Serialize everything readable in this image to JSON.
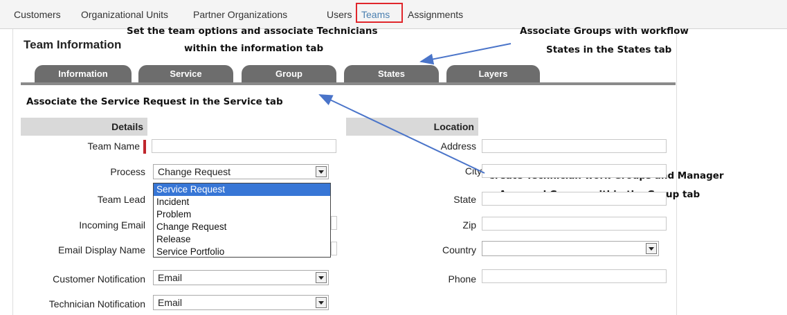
{
  "nav": {
    "items": [
      {
        "label": "Customers"
      },
      {
        "label": "Organizational Units"
      },
      {
        "label": "Partner Organizations"
      },
      {
        "label": "Users"
      },
      {
        "label": "Teams"
      },
      {
        "label": "Assignments"
      }
    ],
    "active": "Teams"
  },
  "panel": {
    "title": "Team Information"
  },
  "tabs": [
    {
      "label": "Information"
    },
    {
      "label": "Service"
    },
    {
      "label": "Group"
    },
    {
      "label": "States"
    },
    {
      "label": "Layers"
    }
  ],
  "callouts": {
    "team_options_line1": "Set the team options and associate Technicians",
    "team_options_line2": "within the information tab",
    "groups_states_line1": "Associate Groups with workflow",
    "groups_states_line2": "States in the States tab",
    "service": "Associate the Service Request in the Service tab",
    "group_line1": "Create Technician work Groups and Manager",
    "group_line2": "Approval Groups within the Group tab"
  },
  "details": {
    "header": "Details",
    "team_name_label": "Team Name",
    "process_label": "Process",
    "process_value": "Change Request",
    "team_lead_label": "Team Lead",
    "incoming_email_label": "Incoming Email",
    "email_display_name_label": "Email Display Name",
    "customer_notification_label": "Customer Notification",
    "customer_notification_value": "Email",
    "technician_notification_label": "Technician Notification",
    "technician_notification_value": "Email"
  },
  "process_options": [
    {
      "label": "Service Request"
    },
    {
      "label": "Incident"
    },
    {
      "label": "Problem"
    },
    {
      "label": "Change Request"
    },
    {
      "label": "Release"
    },
    {
      "label": "Service Portfolio"
    }
  ],
  "process_highlighted": "Service Request",
  "location": {
    "header": "Location",
    "address_label": "Address",
    "city_label": "City",
    "state_label": "State",
    "zip_label": "Zip",
    "country_label": "Country",
    "phone_label": "Phone"
  },
  "colors": {
    "tab_bg": "#6d6d6d",
    "highlight_border": "#e0262b",
    "arrow": "#4a74c9",
    "dropdown_selected": "#3776d6"
  }
}
